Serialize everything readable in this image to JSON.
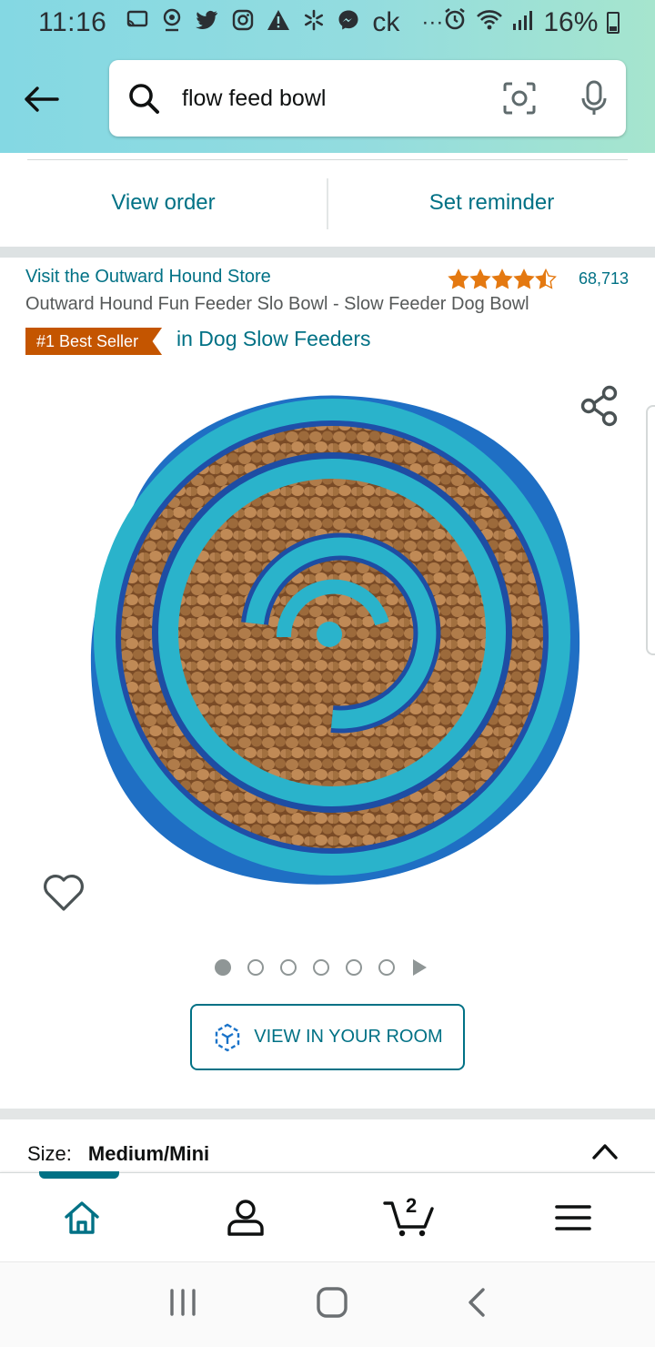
{
  "status_bar": {
    "time": "11:16",
    "carrier_text": "ck",
    "overflow": "···",
    "battery": "16%"
  },
  "search": {
    "query": "flow feed bowl"
  },
  "order_actions": {
    "view_order": "View order",
    "set_reminder": "Set reminder"
  },
  "product": {
    "store_link": "Visit the Outward Hound Store",
    "rating_stars": "★★★★☆",
    "rating_value": 4.5,
    "review_count": "68,713",
    "title": "Outward Hound Fun Feeder Slo Bowl - Slow Feeder Dog Bowl",
    "badge": "#1 Best Seller",
    "badge_category": "in Dog Slow Feeders"
  },
  "gallery": {
    "image_count": 6,
    "active_index": 0
  },
  "view_in_room": "VIEW IN YOUR ROOM",
  "size": {
    "label": "Size:",
    "value": "Medium/Mini"
  },
  "bottom_nav": {
    "cart_count": "2"
  },
  "colors": {
    "accent": "#007185",
    "badge": "#c45500",
    "stars": "#e47911"
  }
}
